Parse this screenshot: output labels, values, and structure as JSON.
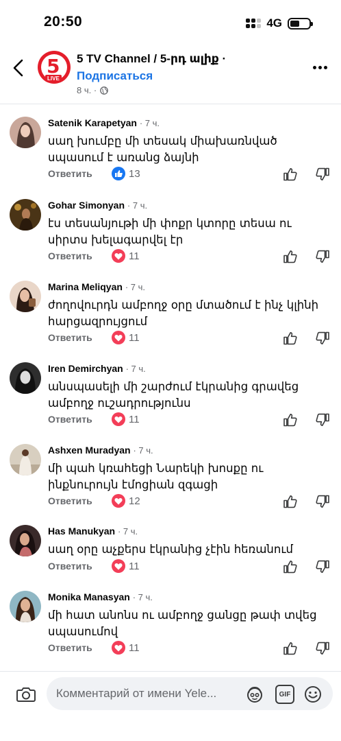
{
  "status_bar": {
    "time": "20:50",
    "network": "4G"
  },
  "header": {
    "page_name": "5 TV Channel / 5-րդ ալիք ·",
    "subscribe_label": "Подписаться",
    "post_age": "8 ч. ·",
    "logo_text": "5",
    "logo_badge": "LIVE",
    "brand_color": "#e41e2b",
    "accent_color": "#1b74e4",
    "icons": {
      "back": "chevron-left-icon",
      "more": "more-horizontal-icon",
      "privacy": "globe-icon"
    }
  },
  "comments": [
    {
      "name": "Satenik Karapetyan",
      "time": "· 7 ч.",
      "text": "սաղ խումբը մի տեսակ միախառնված սպասում է առանց ձայնի",
      "reply_label": "Ответить",
      "reaction": "like",
      "count": "13"
    },
    {
      "name": "Gohar Simonyan",
      "time": "· 7 ч.",
      "text": "էս տեսանյութի մի փոքր կտորը տեսա ու սիրտս խելագարվել էր",
      "reply_label": "Ответить",
      "reaction": "love",
      "count": "11"
    },
    {
      "name": "Marina Meliqyan",
      "time": "· 7 ч.",
      "text": "ժողովուրդն ամբողջ օրը մտածում է ինչ կլինի հարցազրույցում",
      "reply_label": "Ответить",
      "reaction": "love",
      "count": "11"
    },
    {
      "name": "Iren Demirchyan",
      "time": "· 7 ч.",
      "text": "անսպասելի մի շարժում էկրանից գրավեց ամբողջ ուշադրությունս",
      "reply_label": "Ответить",
      "reaction": "love",
      "count": "11"
    },
    {
      "name": "Ashxen Muradyan",
      "time": "· 7 ч.",
      "text": "մի պահ կռահեցի Նարեկի խոսքը ու ինքնուրույն էմոցիան զգացի",
      "reply_label": "Ответить",
      "reaction": "love",
      "count": "12"
    },
    {
      "name": "Has Manukyan",
      "time": "· 7 ч.",
      "text": "սաղ օրը աչքերս էկրանից չէին հեռանում",
      "reply_label": "Ответить",
      "reaction": "love",
      "count": "11"
    },
    {
      "name": "Monika Manasyan",
      "time": "· 7 ч.",
      "text": "մի հատ անոնս ու ամբողջ ցանցը թափ տվեց սպասումով",
      "reply_label": "Ответить",
      "reaction": "love",
      "count": "11"
    }
  ],
  "composer": {
    "placeholder": "Комментарий от имени Yele...",
    "gif_label": "GIF",
    "icons": {
      "camera": "camera-icon",
      "avatar_sticker": "avatar-sticker-icon",
      "gif": "gif-icon",
      "emoji": "emoji-icon"
    }
  }
}
